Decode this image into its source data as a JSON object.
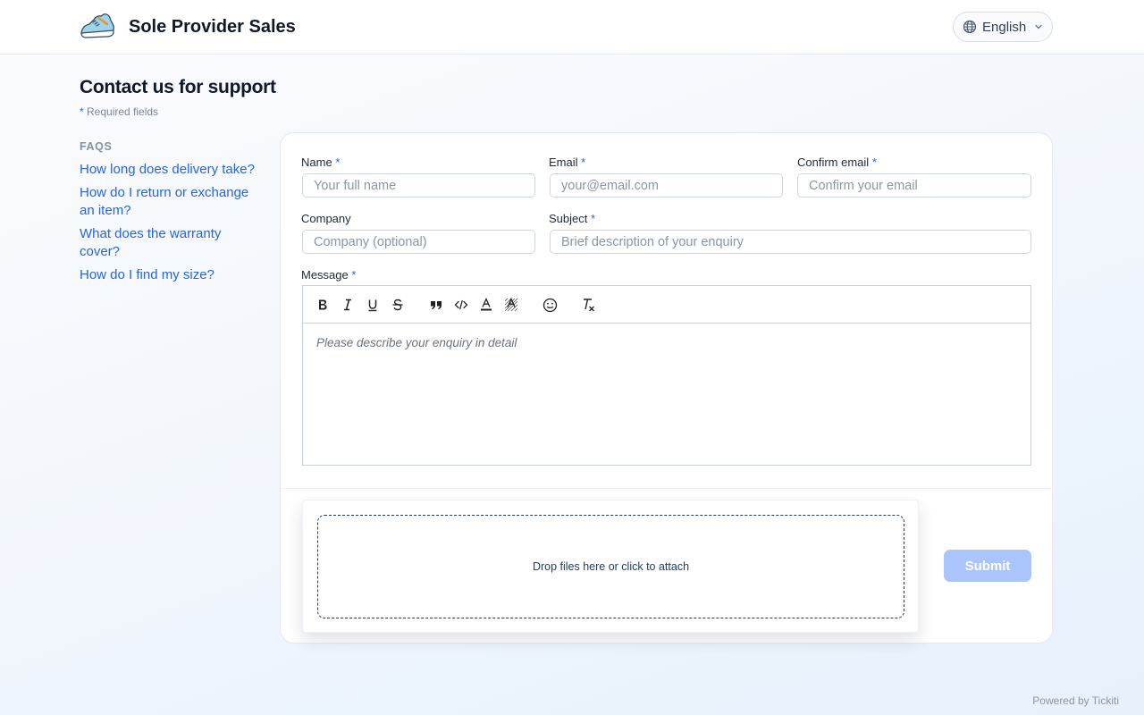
{
  "header": {
    "brand": "Sole Provider Sales",
    "logo_icon": "sneaker-icon",
    "language": "English"
  },
  "page": {
    "title": "Contact us for support",
    "required_star": "*",
    "required_note": "Required fields"
  },
  "faqs": {
    "heading": "FAQS",
    "items": [
      "How long does delivery take?",
      "How do I return or exchange an item?",
      "What does the warranty cover?",
      "How do I find my size?"
    ]
  },
  "form": {
    "name": {
      "label": "Name",
      "placeholder": "Your full name",
      "value": ""
    },
    "email": {
      "label": "Email",
      "placeholder": "your@email.com",
      "value": ""
    },
    "confirm_email": {
      "label": "Confirm email",
      "placeholder": "Confirm your email",
      "value": ""
    },
    "company": {
      "label": "Company",
      "placeholder": "Company (optional)",
      "value": ""
    },
    "subject": {
      "label": "Subject",
      "placeholder": "Brief description of your enquiry",
      "value": ""
    },
    "message": {
      "label": "Message",
      "placeholder": "Please describe your enquiry in detail",
      "value": ""
    },
    "required_marker": "*",
    "toolbar": [
      "bold-icon",
      "italic-icon",
      "underline-icon",
      "strikethrough-icon",
      "blockquote-icon",
      "code-icon",
      "text-color-icon",
      "highlight-icon",
      "emoji-icon",
      "clear-format-icon"
    ],
    "dropzone": "Drop files here or click to attach",
    "submit": "Submit"
  },
  "footer": {
    "powered_by": "Powered by Tickiti"
  },
  "colors": {
    "accent": "#2563eb",
    "submit_disabled": "#a9c5fb"
  }
}
